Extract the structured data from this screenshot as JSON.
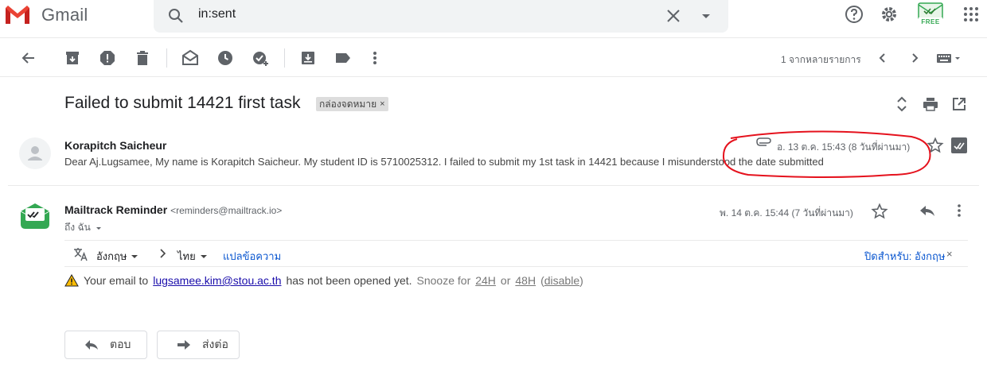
{
  "header": {
    "brand": "Gmail",
    "search_value": "in:sent",
    "badge_text": "FREE"
  },
  "toolbar": {
    "pager_text": "1 จากหลายรายการ"
  },
  "thread": {
    "subject": "Failed to submit 14421 first task",
    "label": "กล่องจดหมาย",
    "label_close": "×"
  },
  "message1": {
    "sender": "Korapitch Saicheur",
    "snippet": "Dear Aj.Lugsamee, My name is Korapitch Saicheur. My student ID is 5710025312. I failed to submit my 1st task in 14421 because I misunderstood the date submitted",
    "date": "อ. 13 ต.ค. 15:43 (8 วันที่ผ่านมา)"
  },
  "message2": {
    "sender": "Mailtrack Reminder",
    "email": "<reminders@mailtrack.io>",
    "to": "ถึง ฉัน",
    "date": "พ. 14 ต.ค. 15:44 (7 วันที่ผ่านมา)"
  },
  "translate": {
    "source_lang": "อังกฤษ",
    "target_lang": "ไทย",
    "translate_link": "แปลข้อความ",
    "turn_off": "ปิดสำหรับ: อังกฤษ",
    "close": "×"
  },
  "notice": {
    "prefix": "Your email to",
    "email": "lugsamee.kim@stou.ac.th",
    "middle": "has not been opened yet.",
    "snooze_label": "Snooze for",
    "opt1": "24H",
    "or": "or",
    "opt2": "48H",
    "open_paren": "(",
    "disable": "disable",
    "close_paren": ")"
  },
  "actions": {
    "reply": "ตอบ",
    "forward": "ส่งต่อ"
  },
  "colors": {
    "gmail_red": "#ea4335",
    "mailtrack_green": "#34a853",
    "annotation_red": "#e5121d"
  }
}
